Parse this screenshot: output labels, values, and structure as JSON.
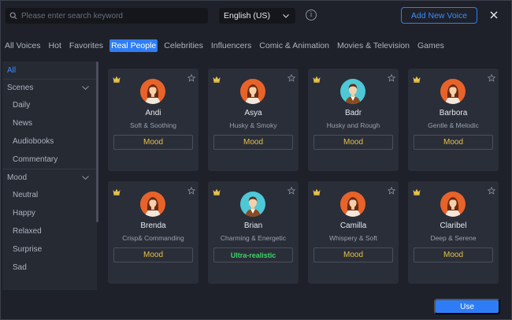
{
  "colors": {
    "accent": "#2f7df6",
    "gold": "#e8c24a",
    "green": "#3fd46a",
    "orange_avatar": "#e8632a",
    "teal_avatar": "#4ec8d6"
  },
  "search": {
    "placeholder": "Please enter search keyword",
    "value": ""
  },
  "language": {
    "selected": "English (US)"
  },
  "info_icon": "i",
  "add_voice_label": "Add New Voice",
  "tabs": [
    {
      "label": "All Voices",
      "active": false
    },
    {
      "label": "Hot",
      "active": false
    },
    {
      "label": "Favorites",
      "active": false
    },
    {
      "label": "Real People",
      "active": true
    },
    {
      "label": "Celebrities",
      "active": false
    },
    {
      "label": "Influencers",
      "active": false
    },
    {
      "label": "Comic & Animation",
      "active": false
    },
    {
      "label": "Movies & Television",
      "active": false
    },
    {
      "label": "Games",
      "active": false
    }
  ],
  "sidebar": {
    "all_label": "All",
    "scenes": {
      "label": "Scenes",
      "items": [
        "Daily",
        "News",
        "Audiobooks",
        "Commentary"
      ]
    },
    "mood": {
      "label": "Mood",
      "items": [
        "Neutral",
        "Happy",
        "Relaxed",
        "Surprise",
        "Sad"
      ]
    }
  },
  "voices": [
    {
      "name": "Andi",
      "desc": "Soft & Soothing",
      "tag": "Mood",
      "avatar": "female-orange"
    },
    {
      "name": "Asya",
      "desc": "Husky & Smoky",
      "tag": "Mood",
      "avatar": "female-orange"
    },
    {
      "name": "Badr",
      "desc": "Husky and Rough",
      "tag": "Mood",
      "avatar": "male-teal"
    },
    {
      "name": "Barbora",
      "desc": "Gentle & Melodic",
      "tag": "Mood",
      "avatar": "female-orange"
    },
    {
      "name": "Brenda",
      "desc": "Crisp& Commanding",
      "tag": "Mood",
      "avatar": "female-orange"
    },
    {
      "name": "Brian",
      "desc": "Charming & Energetic",
      "tag": "Ultra-realistic",
      "avatar": "male-teal"
    },
    {
      "name": "Camilla",
      "desc": "Whispery & Soft",
      "tag": "Mood",
      "avatar": "female-orange"
    },
    {
      "name": "Claribel",
      "desc": "Deep & Serene",
      "tag": "Mood",
      "avatar": "female-orange"
    }
  ],
  "use_label": "Use"
}
